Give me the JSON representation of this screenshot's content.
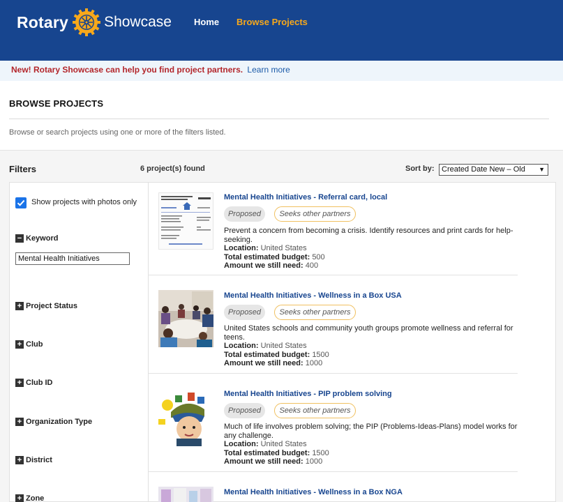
{
  "header": {
    "logo_word": "Rotary",
    "logo_product": "Showcase",
    "nav": [
      {
        "label": "Home",
        "active": false
      },
      {
        "label": "Browse Projects",
        "active": true
      }
    ],
    "bg_color": "#17458f",
    "accent_color": "#f7a81b"
  },
  "banner": {
    "message": "New! Rotary Showcase can help you find project partners.",
    "link": "Learn more"
  },
  "page": {
    "title": "BROWSE PROJECTS",
    "description": "Browse or search projects using one or more of the filters listed."
  },
  "filters": {
    "heading": "Filters",
    "photos_only": {
      "label": "Show projects with photos only",
      "checked": true
    },
    "keyword": {
      "label": "Keyword",
      "value": "Mental Health Initiatives",
      "expanded": true
    },
    "facets": [
      {
        "label": "Project Status",
        "expanded": false
      },
      {
        "label": "Club",
        "expanded": false
      },
      {
        "label": "Club ID",
        "expanded": false
      },
      {
        "label": "Organization Type",
        "expanded": false
      },
      {
        "label": "District",
        "expanded": false
      },
      {
        "label": "Zone",
        "expanded": false
      }
    ]
  },
  "results": {
    "count_label": "6 project(s) found",
    "sort_label": "Sort by:",
    "sort_value": "Created Date New – Old",
    "field_labels": {
      "location": "Location:",
      "budget": "Total estimated budget:",
      "need": "Amount we still need:"
    },
    "items": [
      {
        "title": "Mental Health Initiatives - Referral card, local",
        "tags": [
          "Proposed",
          "Seeks other partners"
        ],
        "description": "Prevent a concern from becoming a crisis. Identify resources and print cards for help-seeking.",
        "location": "United States",
        "budget": "500",
        "need": "400"
      },
      {
        "title": "Mental Health Initiatives - Wellness in a Box USA",
        "tags": [
          "Proposed",
          "Seeks other partners"
        ],
        "description": "United States schools and community youth groups promote wellness and referral for teens.",
        "location": "United States",
        "budget": "1500",
        "need": "1000"
      },
      {
        "title": "Mental Health Initiatives - PIP problem solving",
        "tags": [
          "Proposed",
          "Seeks other partners"
        ],
        "description": "Much of life involves problem solving; the PIP (Problems-Ideas-Plans) model works for any challenge.",
        "location": "United States",
        "budget": "1500",
        "need": "1000"
      },
      {
        "title": "Mental Health Initiatives - Wellness in a Box NGA"
      }
    ]
  }
}
